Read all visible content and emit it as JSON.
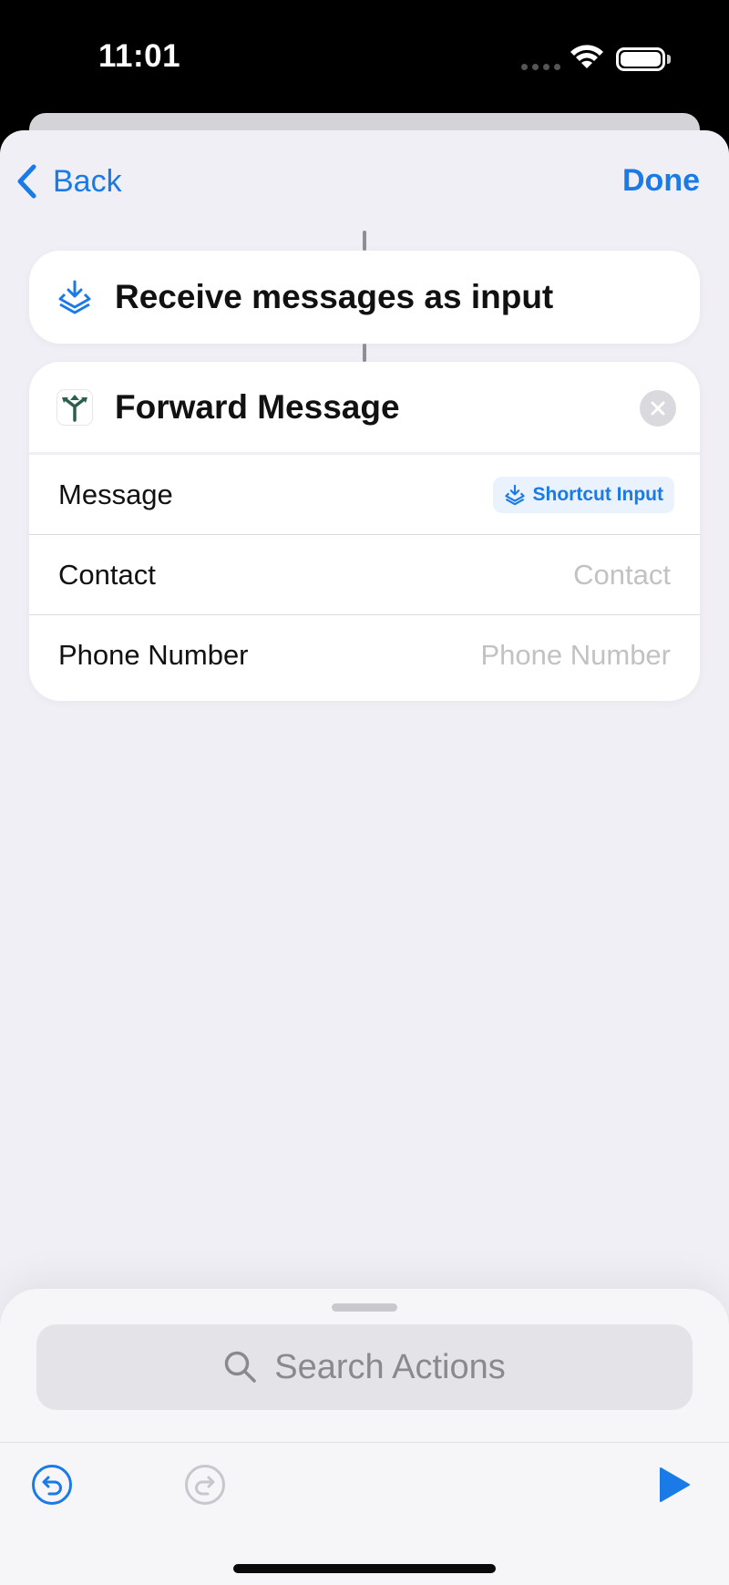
{
  "status_bar": {
    "time": "11:01"
  },
  "nav": {
    "back_label": "Back",
    "done_label": "Done"
  },
  "input_step": {
    "title": "Receive messages as input"
  },
  "action": {
    "title": "Forward Message",
    "params": [
      {
        "label": "Message",
        "value": "Shortcut Input",
        "is_token": true
      },
      {
        "label": "Contact",
        "placeholder": "Contact"
      },
      {
        "label": "Phone Number",
        "placeholder": "Phone Number"
      }
    ]
  },
  "drawer": {
    "search_placeholder": "Search Actions"
  },
  "colors": {
    "accent": "#1a7ae8",
    "app_icon_green": "#2e5e4e",
    "background": "#f0eff5"
  },
  "icons": [
    "chevron-left-icon",
    "input-tray-icon",
    "split-arrows-icon",
    "close-icon",
    "search-icon",
    "undo-icon",
    "redo-icon",
    "play-icon",
    "wifi-icon",
    "battery-icon"
  ]
}
